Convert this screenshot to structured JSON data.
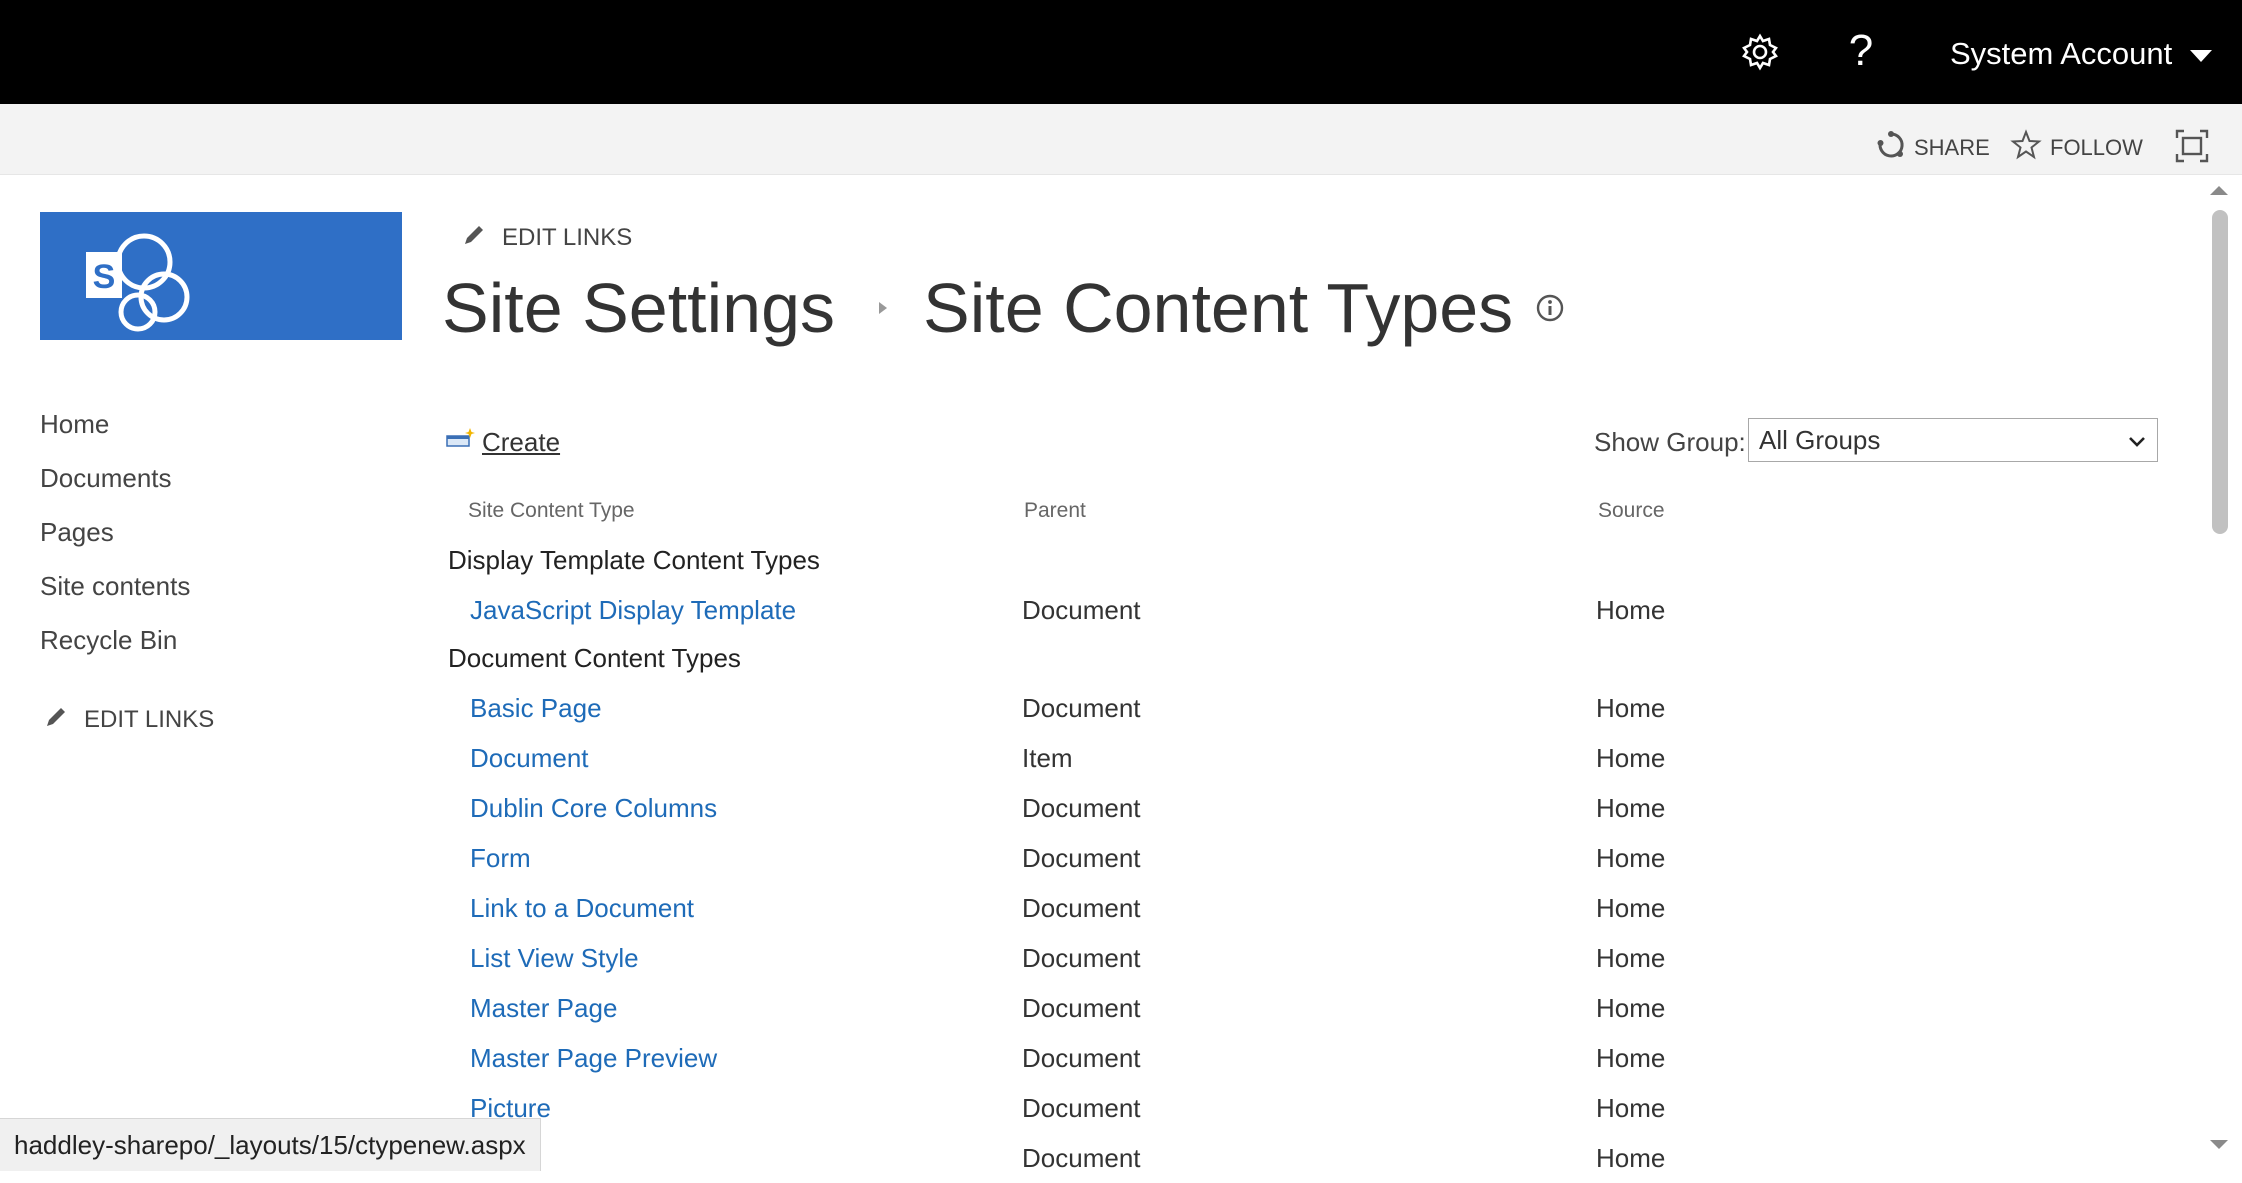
{
  "suitebar": {
    "account_name": "System Account",
    "help_glyph": "?"
  },
  "ribbon": {
    "share_label": "SHARE",
    "follow_label": "FOLLOW"
  },
  "logo": {
    "letter": "S",
    "color": "#2f6fc6"
  },
  "left_nav": {
    "items": [
      "Home",
      "Documents",
      "Pages",
      "Site contents",
      "Recycle Bin"
    ],
    "edit_links": "EDIT LINKS"
  },
  "breadcrumb": {
    "edit_links": "EDIT LINKS",
    "parent": "Site Settings",
    "current": "Site Content Types"
  },
  "toolbar": {
    "create_label": "Create",
    "show_group_label": "Show Group:",
    "show_group_value": "All Groups"
  },
  "table": {
    "headers": [
      "Site Content Type",
      "Parent",
      "Source"
    ],
    "groups": [
      {
        "name": "Display Template Content Types",
        "rows": [
          {
            "name": "JavaScript Display Template",
            "parent": "Document",
            "source": "Home"
          }
        ]
      },
      {
        "name": "Document Content Types",
        "rows": [
          {
            "name": "Basic Page",
            "parent": "Document",
            "source": "Home"
          },
          {
            "name": "Document",
            "parent": "Item",
            "source": "Home"
          },
          {
            "name": "Dublin Core Columns",
            "parent": "Document",
            "source": "Home"
          },
          {
            "name": "Form",
            "parent": "Document",
            "source": "Home"
          },
          {
            "name": "Link to a Document",
            "parent": "Document",
            "source": "Home"
          },
          {
            "name": "List View Style",
            "parent": "Document",
            "source": "Home"
          },
          {
            "name": "Master Page",
            "parent": "Document",
            "source": "Home"
          },
          {
            "name": "Master Page Preview",
            "parent": "Document",
            "source": "Home"
          },
          {
            "name": "Picture",
            "parent": "Document",
            "source": "Home"
          },
          {
            "name": "",
            "parent": "Document",
            "source": "Home"
          }
        ]
      }
    ]
  },
  "status_bar": {
    "url": "haddley-sharepo/_layouts/15/ctypenew.aspx"
  },
  "icons": [
    "gear-icon",
    "help-icon",
    "share-icon",
    "star-icon",
    "focus-icon",
    "pencil-icon",
    "info-icon",
    "new-item-icon",
    "chevron-down-icon"
  ]
}
